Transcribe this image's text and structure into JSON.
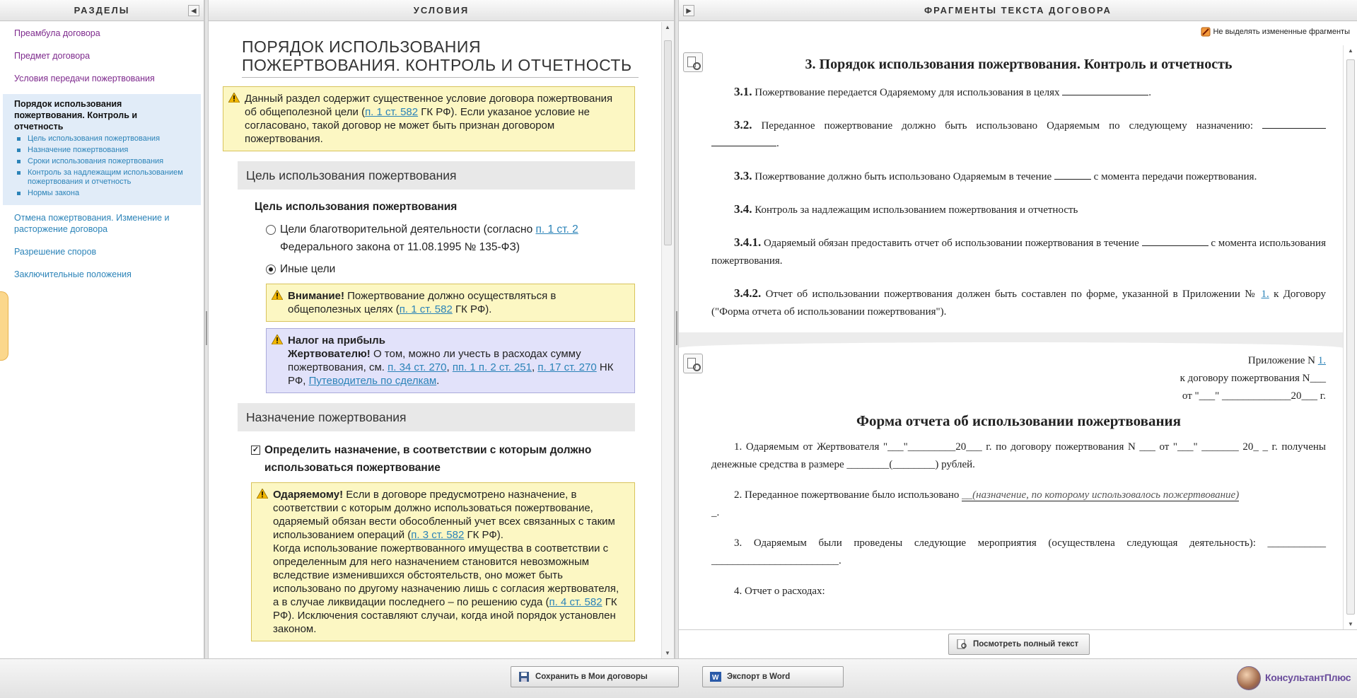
{
  "left": {
    "header": "РАЗДЕЛЫ",
    "items_top": [
      "Преамбула договора",
      "Предмет договора",
      "Условия  передачи пожертвования"
    ],
    "active": {
      "title": "Порядок использования пожертвования. Контроль и отчетность",
      "subs": [
        "Цель использования пожертвования",
        "Назначение пожертвования",
        "Сроки использования пожертвования",
        "Контроль за надлежащим использованием пожертвования и отчетность",
        "Нормы закона"
      ]
    },
    "items_bottom": [
      "Отмена пожертвования. Изменение и расторжение договора",
      "Разрешение споров",
      "Заключительные положения"
    ]
  },
  "middle": {
    "header": "УСЛОВИЯ",
    "title": "ПОРЯДОК ИСПОЛЬЗОВАНИЯ ПОЖЕРТВОВАНИЯ. КОНТРОЛЬ И ОТЧЕТНОСТЬ",
    "intro": {
      "t1": "Данный раздел содержит существенное условие договора пожертвования об общеполезной цели (",
      "link": "п. 1 ст. 582",
      "t2": " ГК РФ). Если указаное условие не согласовано, такой договор не может быть признан договором пожертвования."
    },
    "group1": "Цель использования пожертвования",
    "field1": "Цель использования пожертвования",
    "radio1": {
      "t1": "Цели благотворительной деятельности (согласно ",
      "link": "п. 1 ст. 2",
      "t2": " Федерального закона от 11.08.1995 № 135-ФЗ)"
    },
    "radio2": "Иные цели",
    "note_attention": {
      "bold": "Внимание!",
      "t1": " Пожертвование должно осуществляться в общеполезных целях (",
      "link": "п. 1 ст. 582",
      "t2": " ГК РФ)."
    },
    "note_tax": {
      "b1": "Налог на прибыль",
      "b2": "Жертвователю!",
      "t1": " О том, можно ли учесть в расходах сумму пожертвования, см. ",
      "l1": "п. 34 ст. 270",
      "c1": ", ",
      "l2": "пп. 1 п. 2 ст. 251",
      "c2": ", ",
      "l3": "п. 17 ст. 270",
      "t2": " НК РФ, ",
      "l4": "Путеводитель по сделкам",
      "t3": "."
    },
    "group2": "Назначение пожертвования",
    "check1": "Определить назначение, в соответствии с которым должно использоваться пожертвование",
    "check_mark": "✓",
    "note_done": {
      "bold": "Одаряемому!",
      "t1": " Если в договоре предусмотрено назначение, в соответствии с которым должно использоваться пожертвование, одаряемый обязан вести обособленный учет всех связанных с таким использованием операций (",
      "l1": "п. 3 ст. 582",
      "t2": " ГК РФ).",
      "t3": "Когда использование пожертвованного имущества в соответствии с определенным для него назначением становится невозможным вследствие изменившихся обстоятельств, оно может быть использовано по другому назначению лишь с согласия жертвователя, а в случае ликвидации последнего – по решению суда (",
      "l2": "п. 4 ст. 582",
      "t4": " ГК РФ). Исключения составляют случаи, когда иной порядок установлен законом."
    }
  },
  "right": {
    "header": "ФРАГМЕНТЫ ТЕКСТА ДОГОВОРА",
    "option": "Не выделять измененные фрагменты",
    "h3": "3. Порядок использования пожертвования. Контроль и отчетность",
    "p31n": "3.1.",
    "p31": " Пожертвование передается Одаряемому для использования в целях ",
    "p32n": "3.2.",
    "p32": " Переданное пожертвование должно быть использовано Одаряемым по следующему назначению: ",
    "p33n": "3.3.",
    "p33a": " Пожертвование должно быть использовано Одаряемым в течение ",
    "p33b": " с момента передачи пожертвования.",
    "p34n": "3.4.",
    "p34": " Контроль за надлежащим использованием пожертвования и отчетность",
    "p341n": "3.4.1.",
    "p341a": " Одаряемый обязан предоставить отчет об использовании пожертвования в течение ",
    "p341b": " с момента использования пожертвования.",
    "p342n": "3.4.2.",
    "p342a": " Отчет об использовании пожертвования должен быть составлен по форме, указанной в Приложении № ",
    "p342l": "1.",
    "p342b": " к Договору (\"Форма отчета об использовании пожертвования\").",
    "appendix": {
      "l1": "Приложение N ",
      "l1link": "1.",
      "l2": "к договору пожертвования N___",
      "l3": "от \"___\" _____________20___ г."
    },
    "form_title": "Форма отчета об использовании пожертвования",
    "f1": "1. Одаряемым от Жертвователя \"___\"_________20___ г. по договору пожертвования N ___ от \"___\" _______ 20_ _ г. получены денежные средства в размере ________(________) рублей.",
    "f2a": "2. Переданное пожертвование было использовано ",
    "f2i": "__(назначение, по которому использовалось пожертвование)",
    "f2b": "_.",
    "f3": "3. Одаряемым были проведены следующие мероприятия (осуществлена следующая деятельность): ___________ ________________________.",
    "f4": "4. Отчет о расходах:",
    "view_full": "Посмотреть полный текст"
  },
  "footer": {
    "save": "Сохранить в Мои договоры",
    "export": "Экспорт в Word",
    "brand": "КонсультантПлюс"
  }
}
